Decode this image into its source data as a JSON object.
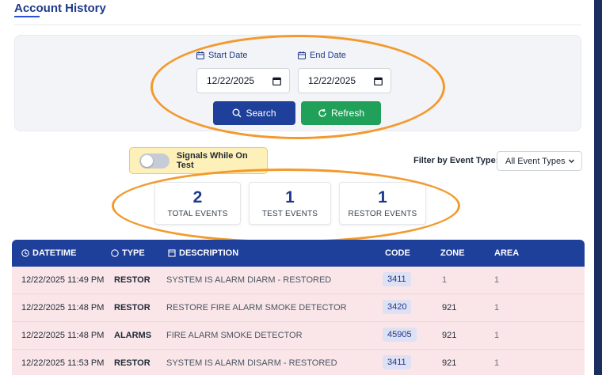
{
  "page": {
    "title": "Account History"
  },
  "filters": {
    "start_date": {
      "label": "Start Date",
      "value": "12/22/2025"
    },
    "end_date": {
      "label": "End Date",
      "value": "12/22/2025"
    },
    "search_label": "Search",
    "refresh_label": "Refresh"
  },
  "signals_toggle": {
    "label": "Signals While On Test",
    "on": false
  },
  "event_filter": {
    "label": "Filter by Event Type:",
    "selected": "All Event Types"
  },
  "stats": [
    {
      "value": "2",
      "label": "TOTAL EVENTS"
    },
    {
      "value": "1",
      "label": "TEST EVENTS"
    },
    {
      "value": "1",
      "label": "RESTOR EVENTS"
    }
  ],
  "table": {
    "columns": [
      "DATETIME",
      "TYPE",
      "DESCRIPTION",
      "CODE",
      "ZONE",
      "AREA"
    ],
    "rows": [
      {
        "datetime": "12/22/2025 11:49 PM",
        "type": "RESTOR",
        "description": "SYSTEM IS ALARM DIARM - RESTORED",
        "code": "3411",
        "zone": "1",
        "area": "1"
      },
      {
        "datetime": "12/22/2025 11:48 PM",
        "type": "RESTOR",
        "description": "RESTORE FIRE ALARM SMOKE DETECTOR",
        "code": "3420",
        "zone": "921",
        "area": "1"
      },
      {
        "datetime": "12/22/2025 11:48 PM",
        "type": "ALARMS",
        "description": "FIRE ALARM SMOKE DETECTOR",
        "code": "45905",
        "zone": "921",
        "area": "1"
      },
      {
        "datetime": "12/22/2025 11:53 PM",
        "type": "RESTOR",
        "description": "SYSTEM IS ALARM DISARM - RESTORED",
        "code": "3411",
        "zone": "921",
        "area": "1"
      }
    ]
  },
  "colors": {
    "primary": "#1e3f9a",
    "success": "#21a05a",
    "highlight_ring": "#f29a2e",
    "row_bg": "#fae6e8"
  },
  "icons": {
    "date": "calendar-icon",
    "search": "magnifier-icon",
    "refresh": "refresh-icon",
    "datetime_col": "clock-icon",
    "type_col": "circle-icon",
    "description_col": "document-icon"
  }
}
